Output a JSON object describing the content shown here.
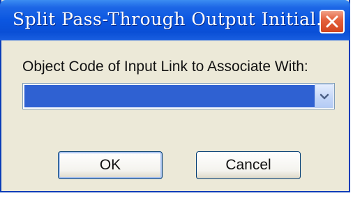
{
  "window": {
    "title": "Split Pass-Through Output Initial...",
    "close_icon": "close-icon"
  },
  "form": {
    "label": "Object Code of Input Link to Associate With:",
    "select_value": "",
    "dropdown_icon": "chevron-down-icon"
  },
  "buttons": {
    "ok_label": "OK",
    "cancel_label": "Cancel"
  },
  "colors": {
    "title_bar": "#0b56e0",
    "dialog_background": "#ece9d8",
    "selection": "#2f61d2",
    "close_button": "#e5623e"
  }
}
